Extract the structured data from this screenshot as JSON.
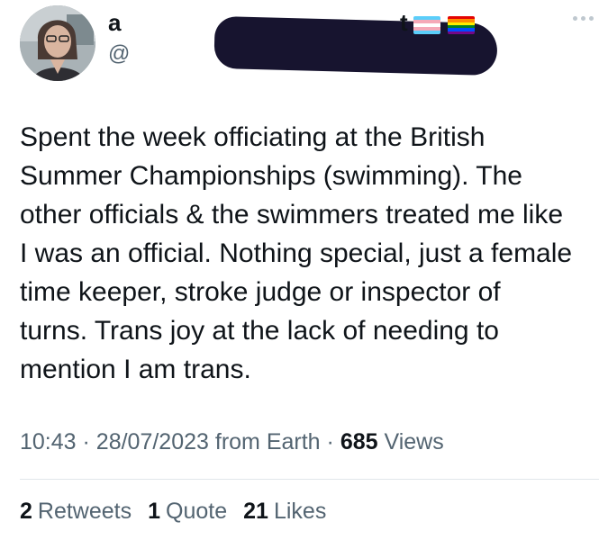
{
  "author": {
    "display_name": "a",
    "display_name_suffix": "t",
    "handle": "@",
    "flags": [
      "transgender-flag-icon",
      "rainbow-flag-icon"
    ]
  },
  "tweet": {
    "text": "Spent the week officiating at the British\nSummer Championships (swimming). The\nother officials & the swimmers treated me like\nI was an official. Nothing special, just a female\ntime keeper, stroke judge or inspector of\nturns. Trans joy at the lack of needing to\nmention I am trans."
  },
  "meta": {
    "time": "10:43",
    "date": "28/07/2023",
    "source": "from Earth",
    "views_count": "685",
    "views_label": "Views"
  },
  "stats": {
    "retweets_count": "2",
    "retweets_label": "Retweets",
    "quotes_count": "1",
    "quotes_label": "Quote",
    "likes_count": "21",
    "likes_label": "Likes"
  },
  "colors": {
    "text": "#0f1419",
    "secondary": "#536471",
    "divider": "#e1e6ea",
    "redaction": "#17142f"
  }
}
